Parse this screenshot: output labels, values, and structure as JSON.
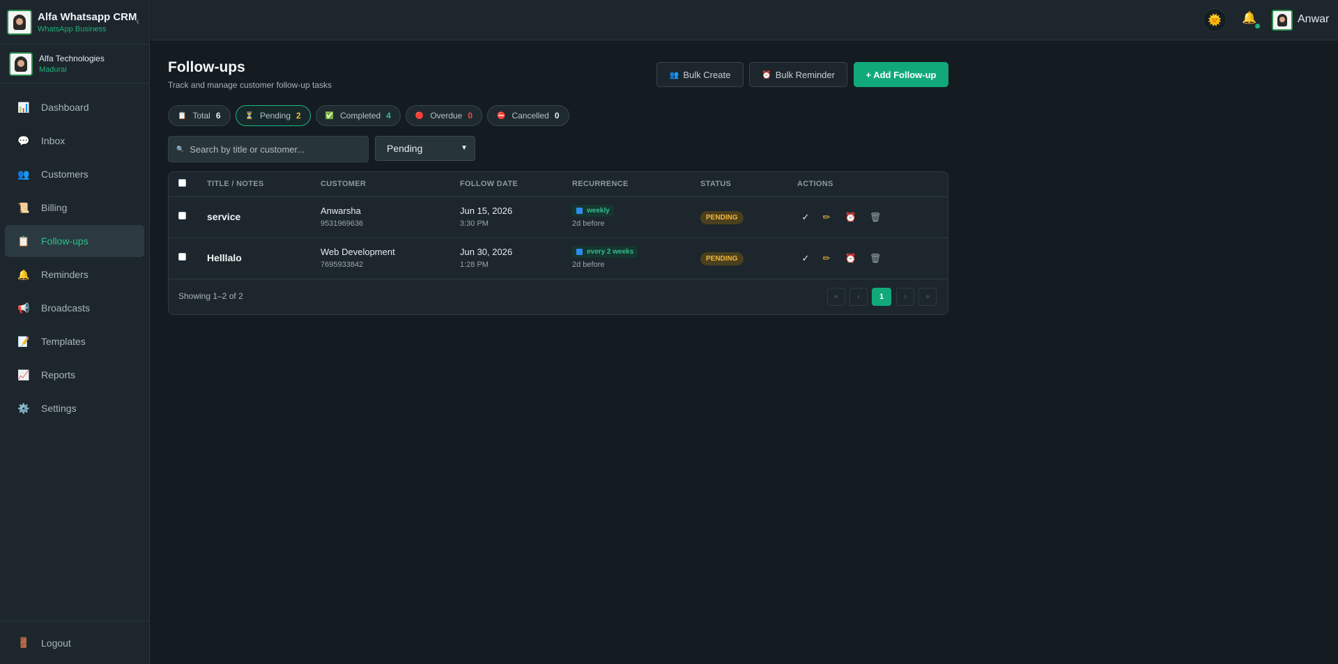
{
  "app": {
    "title": "Alfa Whatsapp CRM",
    "subtitle": "WhatsApp Business",
    "collapse_icon": "chevron-left-icon"
  },
  "org": {
    "name": "Alfa Technologies",
    "location": "Madurai"
  },
  "sidebar": {
    "items": [
      {
        "label": "Dashboard",
        "icon": "bar-chart-icon",
        "glyph": "📊"
      },
      {
        "label": "Inbox",
        "icon": "message-icon",
        "glyph": "💬"
      },
      {
        "label": "Customers",
        "icon": "users-icon",
        "glyph": "👥"
      },
      {
        "label": "Billing",
        "icon": "receipt-icon",
        "glyph": "📜"
      },
      {
        "label": "Follow-ups",
        "icon": "clipboard-icon",
        "glyph": "📋",
        "active": true
      },
      {
        "label": "Reminders",
        "icon": "bell-icon",
        "glyph": "🔔"
      },
      {
        "label": "Broadcasts",
        "icon": "megaphone-icon",
        "glyph": "📢"
      },
      {
        "label": "Templates",
        "icon": "memo-icon",
        "glyph": "📝"
      },
      {
        "label": "Reports",
        "icon": "chart-up-icon",
        "glyph": "📈"
      },
      {
        "label": "Settings",
        "icon": "gear-icon",
        "glyph": "⚙️"
      }
    ],
    "logout": {
      "label": "Logout",
      "icon": "door-icon",
      "glyph": "🚪"
    }
  },
  "topbar": {
    "theme_icon": "sun-icon",
    "theme_glyph": "🌞",
    "notif_icon": "bell-icon",
    "notif_glyph": "🔔",
    "user": "Anwar"
  },
  "page": {
    "title": "Follow-ups",
    "subtitle": "Track and manage customer follow-up tasks",
    "buttons": {
      "bulk_create": "Bulk Create",
      "bulk_create_glyph": "👥",
      "bulk_reminder": "Bulk Reminder",
      "bulk_reminder_glyph": "⏰",
      "add": "+ Add Follow-up"
    }
  },
  "filters": [
    {
      "label": "Total",
      "count": "6",
      "glyph": "📋",
      "tone": ""
    },
    {
      "label": "Pending",
      "count": "2",
      "glyph": "⏳",
      "tone": "yellow",
      "active": true
    },
    {
      "label": "Completed",
      "count": "4",
      "glyph": "✅",
      "tone": "green"
    },
    {
      "label": "Overdue",
      "count": "0",
      "glyph": "🔴",
      "tone": "red"
    },
    {
      "label": "Cancelled",
      "count": "0",
      "glyph": "⛔",
      "tone": ""
    }
  ],
  "search": {
    "placeholder": "Search by title or customer...",
    "value": "",
    "icon": "search-icon",
    "glyph": "🔍"
  },
  "status_select": {
    "value": "Pending",
    "icon": "chevron-down-icon"
  },
  "table": {
    "headers": {
      "title": "TITLE / NOTES",
      "customer": "CUSTOMER",
      "date": "FOLLOW DATE",
      "recurrence": "RECURRENCE",
      "status": "STATUS",
      "actions": "ACTIONS"
    },
    "rows": [
      {
        "title": "service",
        "customer": "Anwarsha",
        "phone": "9531969636",
        "date": "Jun 15, 2026",
        "time": "3:30 PM",
        "recurrence": "weekly",
        "before": "2d before",
        "status": "PENDING"
      },
      {
        "title": "Helllalo",
        "customer": "Web Development",
        "phone": "7695933842",
        "date": "Jun 30, 2026",
        "time": "1:28 PM",
        "recurrence": "every 2 weeks",
        "before": "2d before",
        "status": "PENDING"
      }
    ],
    "actions": {
      "complete_glyph": "✓",
      "edit_glyph": "✏",
      "reminder_glyph": "⏰",
      "delete_glyph": "🗑"
    },
    "footer": {
      "showing": "Showing 1–2 of 2",
      "pages": [
        "«",
        "‹",
        "1",
        "›",
        "»"
      ],
      "current_page": "1"
    }
  }
}
